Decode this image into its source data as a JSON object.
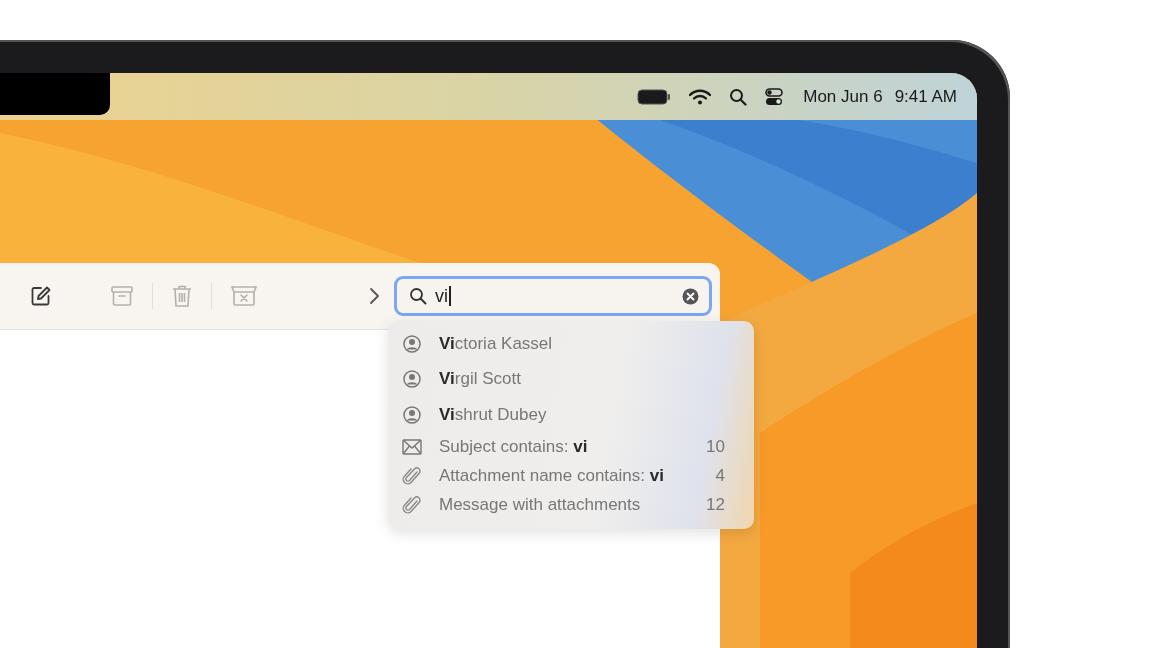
{
  "menu_bar": {
    "date": "Mon Jun 6",
    "time": "9:41 AM"
  },
  "toolbar": {
    "buttons": [
      {
        "kind": "compose",
        "disabled": false
      },
      {
        "kind": "archive",
        "disabled": true
      },
      {
        "kind": "trash",
        "disabled": true
      },
      {
        "kind": "junk",
        "disabled": true
      },
      {
        "kind": "more",
        "disabled": false
      }
    ]
  },
  "search": {
    "value": "vi"
  },
  "suggestions": [
    {
      "kind": "person",
      "label": "**Vi**ctoria Kassel"
    },
    {
      "kind": "person",
      "label": "**Vi**rgil Scott"
    },
    {
      "kind": "person",
      "label": "**Vi**shrut Dubey"
    },
    {
      "kind": "subject",
      "label": "Subject contains: **vi**",
      "count": "10"
    },
    {
      "kind": "attachment",
      "label": "Attachment name contains: **vi**",
      "count": "4"
    },
    {
      "kind": "attachment",
      "label": "Message with attachments",
      "count": "12"
    }
  ]
}
